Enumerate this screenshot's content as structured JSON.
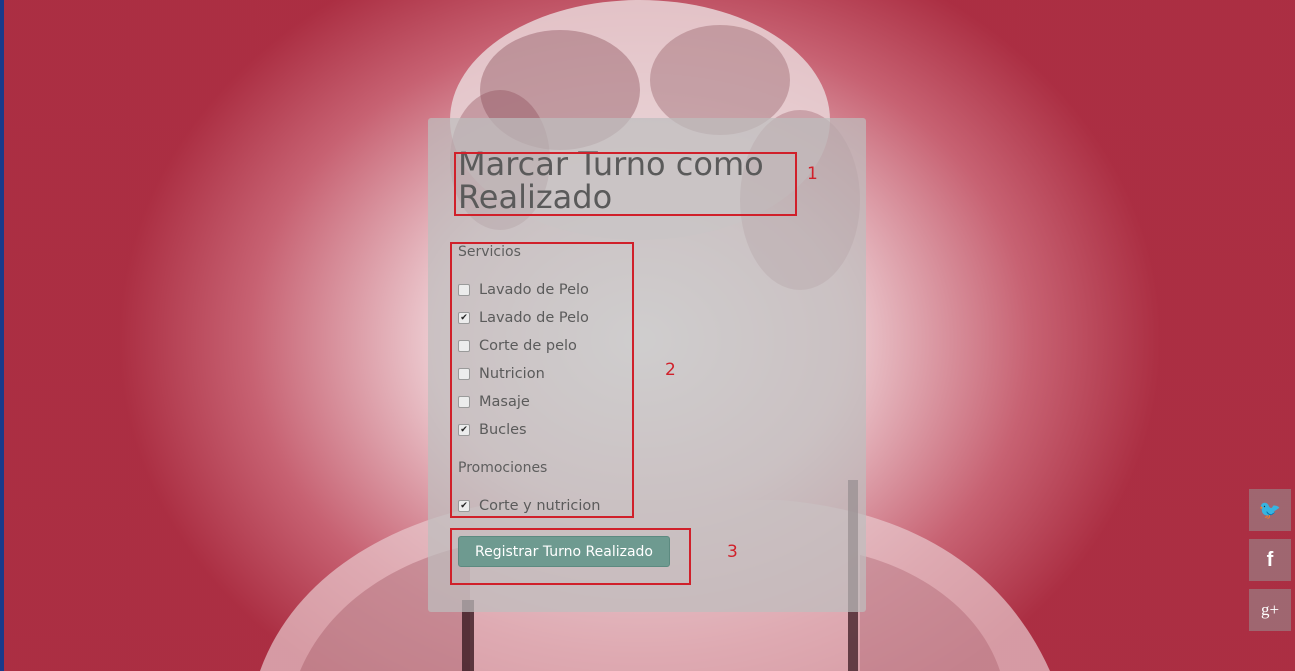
{
  "form": {
    "title": "Marcar Turno como Realizado",
    "services_label": "Servicios",
    "services": [
      {
        "label": "Lavado de Pelo",
        "checked": false
      },
      {
        "label": "Lavado de Pelo",
        "checked": true
      },
      {
        "label": "Corte de pelo",
        "checked": false
      },
      {
        "label": "Nutricion",
        "checked": false
      },
      {
        "label": "Masaje",
        "checked": false
      },
      {
        "label": "Bucles",
        "checked": true
      }
    ],
    "promotions_label": "Promociones",
    "promotions": [
      {
        "label": "Corte y nutricion",
        "checked": true
      }
    ],
    "submit_label": "Registrar Turno Realizado"
  },
  "annotations": [
    "1",
    "2",
    "3"
  ],
  "social": {
    "icons": [
      "twitter-icon",
      "facebook-icon",
      "google-plus-icon"
    ],
    "glyphs": [
      "🐦",
      "f",
      "g+"
    ]
  },
  "colors": {
    "annotation": "#d0202a",
    "button": "#6e9a90",
    "card": "#bebebe"
  }
}
